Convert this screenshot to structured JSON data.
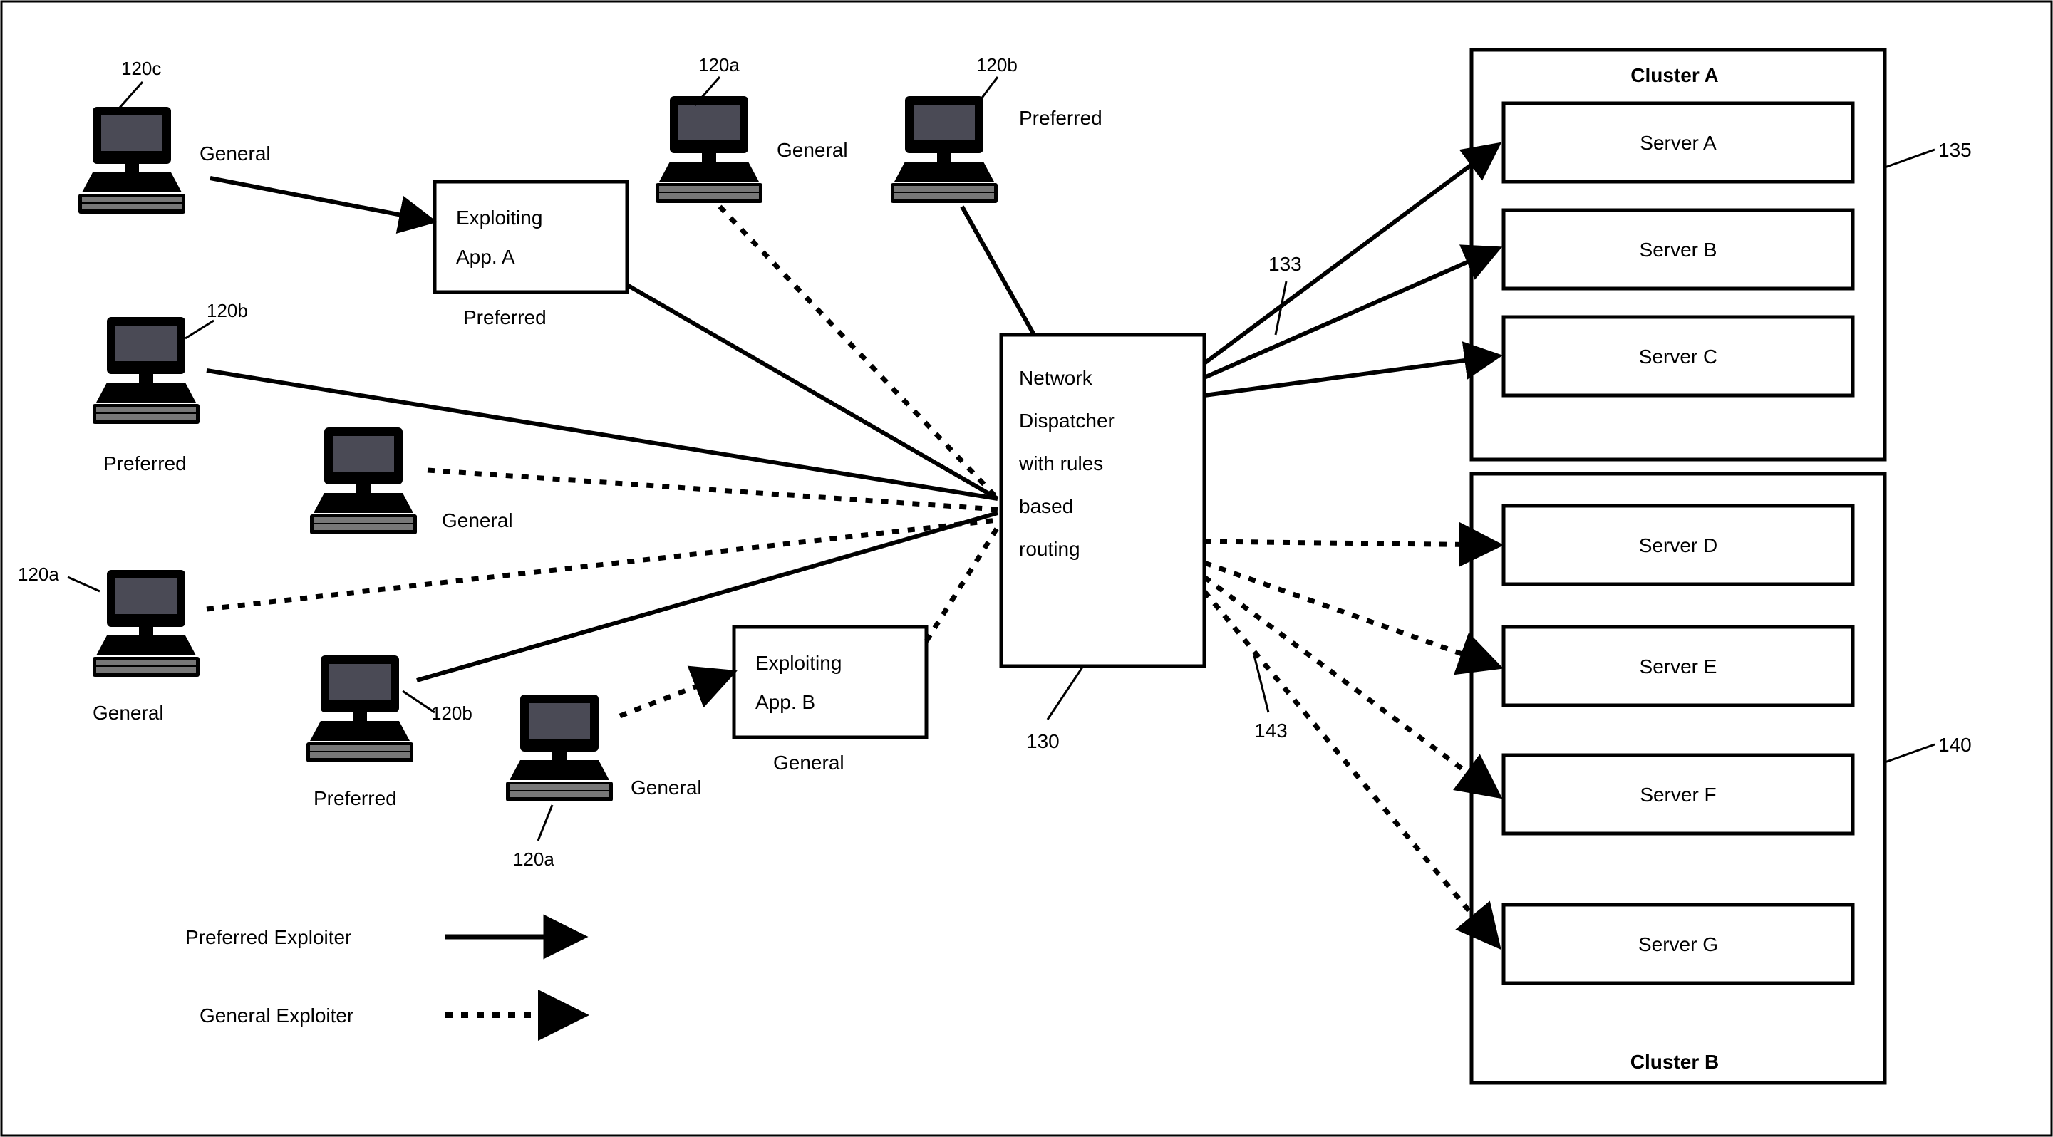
{
  "computers": [
    {
      "id": "c1",
      "ref": "120c",
      "label": "General"
    },
    {
      "id": "c2",
      "ref": "120a",
      "label": "General"
    },
    {
      "id": "c3",
      "ref": "120b",
      "label": "Preferred"
    },
    {
      "id": "c4",
      "ref": "120b",
      "label": "Preferred"
    },
    {
      "id": "c5",
      "ref": "",
      "label": "General"
    },
    {
      "id": "c6",
      "ref": "120a",
      "label": "General"
    },
    {
      "id": "c7",
      "ref": "120b",
      "label": "Preferred"
    },
    {
      "id": "c8",
      "ref": "120a",
      "label": "General"
    }
  ],
  "apps": {
    "a": {
      "line1": "Exploiting",
      "line2": "App.  A",
      "sublabel": "Preferred"
    },
    "b": {
      "line1": "Exploiting",
      "line2": "App.  B",
      "sublabel": "General"
    }
  },
  "dispatcher": {
    "line1": "Network",
    "line2": "Dispatcher",
    "line3": "with rules",
    "line4": "based",
    "line5": "routing",
    "ref": "130",
    "topRef": "133",
    "botRef": "143"
  },
  "clusterA": {
    "title": "Cluster A",
    "ref": "135",
    "servers": [
      "Server A",
      "Server B",
      "Server C"
    ]
  },
  "clusterB": {
    "title": "Cluster B",
    "ref": "140",
    "servers": [
      "Server D",
      "Server E",
      "Server F",
      "Server G"
    ]
  },
  "legend": {
    "preferred": "Preferred Exploiter",
    "general": "General Exploiter"
  }
}
